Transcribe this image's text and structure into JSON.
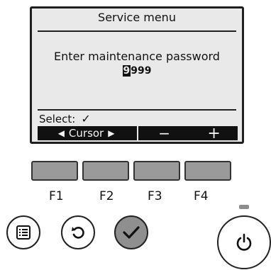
{
  "screen": {
    "title": "Service menu",
    "prompt": "Enter maintenance password",
    "password": {
      "active_digit": "9",
      "rest": "999"
    },
    "select_label": "Select:",
    "select_icon": "check-icon"
  },
  "function_bar": {
    "f1_f2_label": "Cursor",
    "f1_f2_icons": [
      "left-arrow-icon",
      "right-arrow-icon"
    ],
    "f3_label": "−",
    "f4_label": "+"
  },
  "function_keys": [
    "F1",
    "F2",
    "F3",
    "F4"
  ],
  "buttons": [
    {
      "name": "menu",
      "icon": "menu-icon"
    },
    {
      "name": "return",
      "icon": "return-icon"
    },
    {
      "name": "select",
      "icon": "check-icon"
    },
    {
      "name": "on-off",
      "icon": "power-icon"
    }
  ],
  "colors": {
    "screen_bg": "#e9e9e9",
    "key_fill": "#9a9a9a",
    "select_button_fill": "#8f8f8f",
    "bar_bg": "#111111"
  }
}
